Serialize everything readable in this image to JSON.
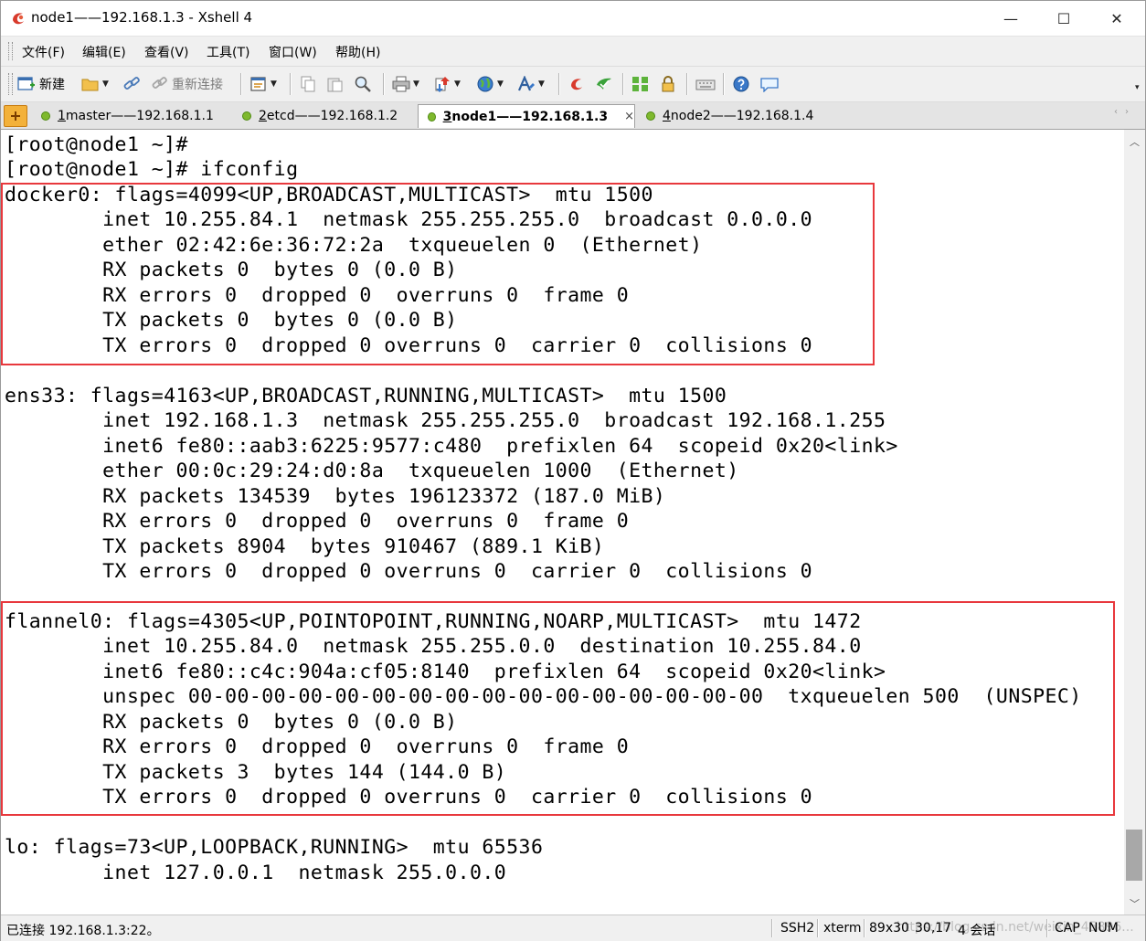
{
  "window": {
    "title": "node1——192.168.1.3 - Xshell 4",
    "minimize_label": "—",
    "maximize_label": "☐",
    "close_label": "✕"
  },
  "menu": [
    "文件(F)",
    "编辑(E)",
    "查看(V)",
    "工具(T)",
    "窗口(W)",
    "帮助(H)"
  ],
  "toolbar": {
    "new_label": "新建",
    "reconnect_label": "重新连接"
  },
  "tabs": [
    {
      "num": "1",
      "label": " master——192.168.1.1"
    },
    {
      "num": "2",
      "label": " etcd——192.168.1.2"
    },
    {
      "num": "3",
      "label": " node1——192.168.1.3"
    },
    {
      "num": "4",
      "label": " node2——192.168.1.4"
    }
  ],
  "active_tab_close": "×",
  "terminal": {
    "lines": [
      "[root@node1 ~]#",
      "[root@node1 ~]# ifconfig",
      "docker0: flags=4099<UP,BROADCAST,MULTICAST>  mtu 1500",
      "        inet 10.255.84.1  netmask 255.255.255.0  broadcast 0.0.0.0",
      "        ether 02:42:6e:36:72:2a  txqueuelen 0  (Ethernet)",
      "        RX packets 0  bytes 0 (0.0 B)",
      "        RX errors 0  dropped 0  overruns 0  frame 0",
      "        TX packets 0  bytes 0 (0.0 B)",
      "        TX errors 0  dropped 0 overruns 0  carrier 0  collisions 0",
      "",
      "ens33: flags=4163<UP,BROADCAST,RUNNING,MULTICAST>  mtu 1500",
      "        inet 192.168.1.3  netmask 255.255.255.0  broadcast 192.168.1.255",
      "        inet6 fe80::aab3:6225:9577:c480  prefixlen 64  scopeid 0x20<link>",
      "        ether 00:0c:29:24:d0:8a  txqueuelen 1000  (Ethernet)",
      "        RX packets 134539  bytes 196123372 (187.0 MiB)",
      "        RX errors 0  dropped 0  overruns 0  frame 0",
      "        TX packets 8904  bytes 910467 (889.1 KiB)",
      "        TX errors 0  dropped 0 overruns 0  carrier 0  collisions 0",
      "",
      "flannel0: flags=4305<UP,POINTOPOINT,RUNNING,NOARP,MULTICAST>  mtu 1472",
      "        inet 10.255.84.0  netmask 255.255.0.0  destination 10.255.84.0",
      "        inet6 fe80::c4c:904a:cf05:8140  prefixlen 64  scopeid 0x20<link>",
      "        unspec 00-00-00-00-00-00-00-00-00-00-00-00-00-00-00-00  txqueuelen 500  (UNSPEC)",
      "        RX packets 0  bytes 0 (0.0 B)",
      "        RX errors 0  dropped 0  overruns 0  frame 0",
      "        TX packets 3  bytes 144 (144.0 B)",
      "        TX errors 0  dropped 0 overruns 0  carrier 0  collisions 0",
      "",
      "lo: flags=73<UP,LOOPBACK,RUNNING>  mtu 65536",
      "        inet 127.0.0.1  netmask 255.0.0.0"
    ]
  },
  "statusbar": {
    "connection": "已连接 192.168.1.3:22。",
    "protocol": "SSH2",
    "term_type": "xterm",
    "size": "89x30",
    "cursor": "30,17",
    "sessions": "4 会话",
    "caps": "CAP",
    "num": "NUM",
    "watermark": "https://blog.csdn.net/weixin_45896..."
  },
  "colors": {
    "highlight_box": "#e8383d",
    "tab_dot": "#7fb92e",
    "chrome_bg": "#f0f0f0"
  }
}
